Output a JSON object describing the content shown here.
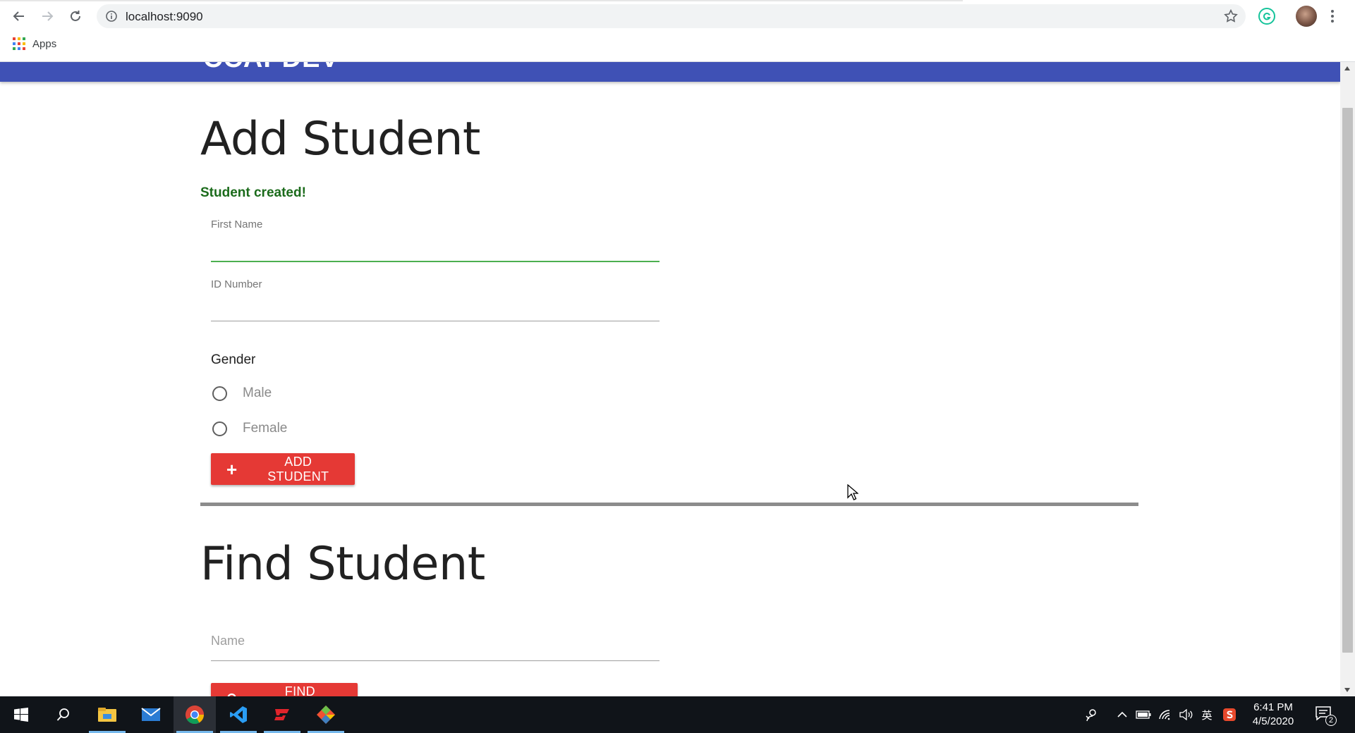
{
  "browser": {
    "url": "localhost:9090",
    "bookmarks_label": "Apps"
  },
  "app": {
    "brand": "CCAPDEV",
    "primary_color": "#3f51b5",
    "accent_color": "#e53935"
  },
  "add_student": {
    "title": "Add Student",
    "status_message": "Student created!",
    "first_name_label": "First Name",
    "first_name_value": "",
    "id_number_label": "ID Number",
    "id_number_value": "",
    "gender_label": "Gender",
    "gender_options": [
      "Male",
      "Female"
    ],
    "submit_icon": "plus-icon",
    "submit_label": "ADD STUDENT"
  },
  "find_student": {
    "title": "Find Student",
    "name_placeholder": "Name",
    "name_value": "",
    "submit_icon": "search-icon",
    "submit_label": "FIND STUDENT"
  },
  "taskbar": {
    "apps": [
      "windows-start-icon",
      "search-icon",
      "file-explorer-icon",
      "mail-icon",
      "chrome-icon",
      "vscode-icon",
      "garena-icon",
      "git-icon"
    ],
    "ime": "英",
    "time": "6:41 PM",
    "date": "4/5/2020",
    "notification_count": "2"
  }
}
